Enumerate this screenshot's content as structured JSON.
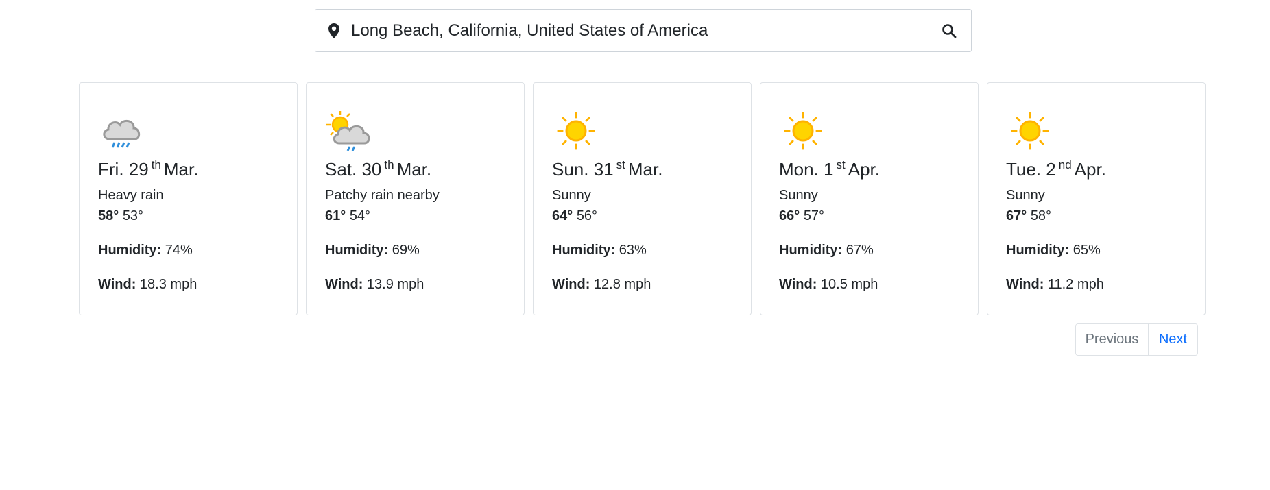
{
  "search": {
    "value": "Long Beach, California, United States of America",
    "pin_icon": "map-pin-icon",
    "search_icon": "search-icon"
  },
  "forecast": [
    {
      "day": "Fri. 29",
      "suffix": "th",
      "month": "Mar.",
      "icon": "rain-cloud-icon",
      "condition": "Heavy rain",
      "high": "58°",
      "low": "53°",
      "humidity_label": "Humidity:",
      "humidity": "74%",
      "wind_label": "Wind:",
      "wind": "18.3 mph"
    },
    {
      "day": "Sat. 30",
      "suffix": "th",
      "month": "Mar.",
      "icon": "sun-cloud-rain-icon",
      "condition": "Patchy rain nearby",
      "high": "61°",
      "low": "54°",
      "humidity_label": "Humidity:",
      "humidity": "69%",
      "wind_label": "Wind:",
      "wind": "13.9 mph"
    },
    {
      "day": "Sun. 31",
      "suffix": "st",
      "month": "Mar.",
      "icon": "sun-icon",
      "condition": "Sunny",
      "high": "64°",
      "low": "56°",
      "humidity_label": "Humidity:",
      "humidity": "63%",
      "wind_label": "Wind:",
      "wind": "12.8 mph"
    },
    {
      "day": "Mon. 1",
      "suffix": "st",
      "month": "Apr.",
      "icon": "sun-icon",
      "condition": "Sunny",
      "high": "66°",
      "low": "57°",
      "humidity_label": "Humidity:",
      "humidity": "67%",
      "wind_label": "Wind:",
      "wind": "10.5 mph"
    },
    {
      "day": "Tue. 2",
      "suffix": "nd",
      "month": "Apr.",
      "icon": "sun-icon",
      "condition": "Sunny",
      "high": "67°",
      "low": "58°",
      "humidity_label": "Humidity:",
      "humidity": "65%",
      "wind_label": "Wind:",
      "wind": "11.2 mph"
    }
  ],
  "pagination": {
    "previous": "Previous",
    "next": "Next"
  },
  "colors": {
    "link": "#0d6efd",
    "muted": "#6c757d",
    "border": "#dee2e6",
    "sun": "#ffd400",
    "rain": "#2f8fdb"
  }
}
